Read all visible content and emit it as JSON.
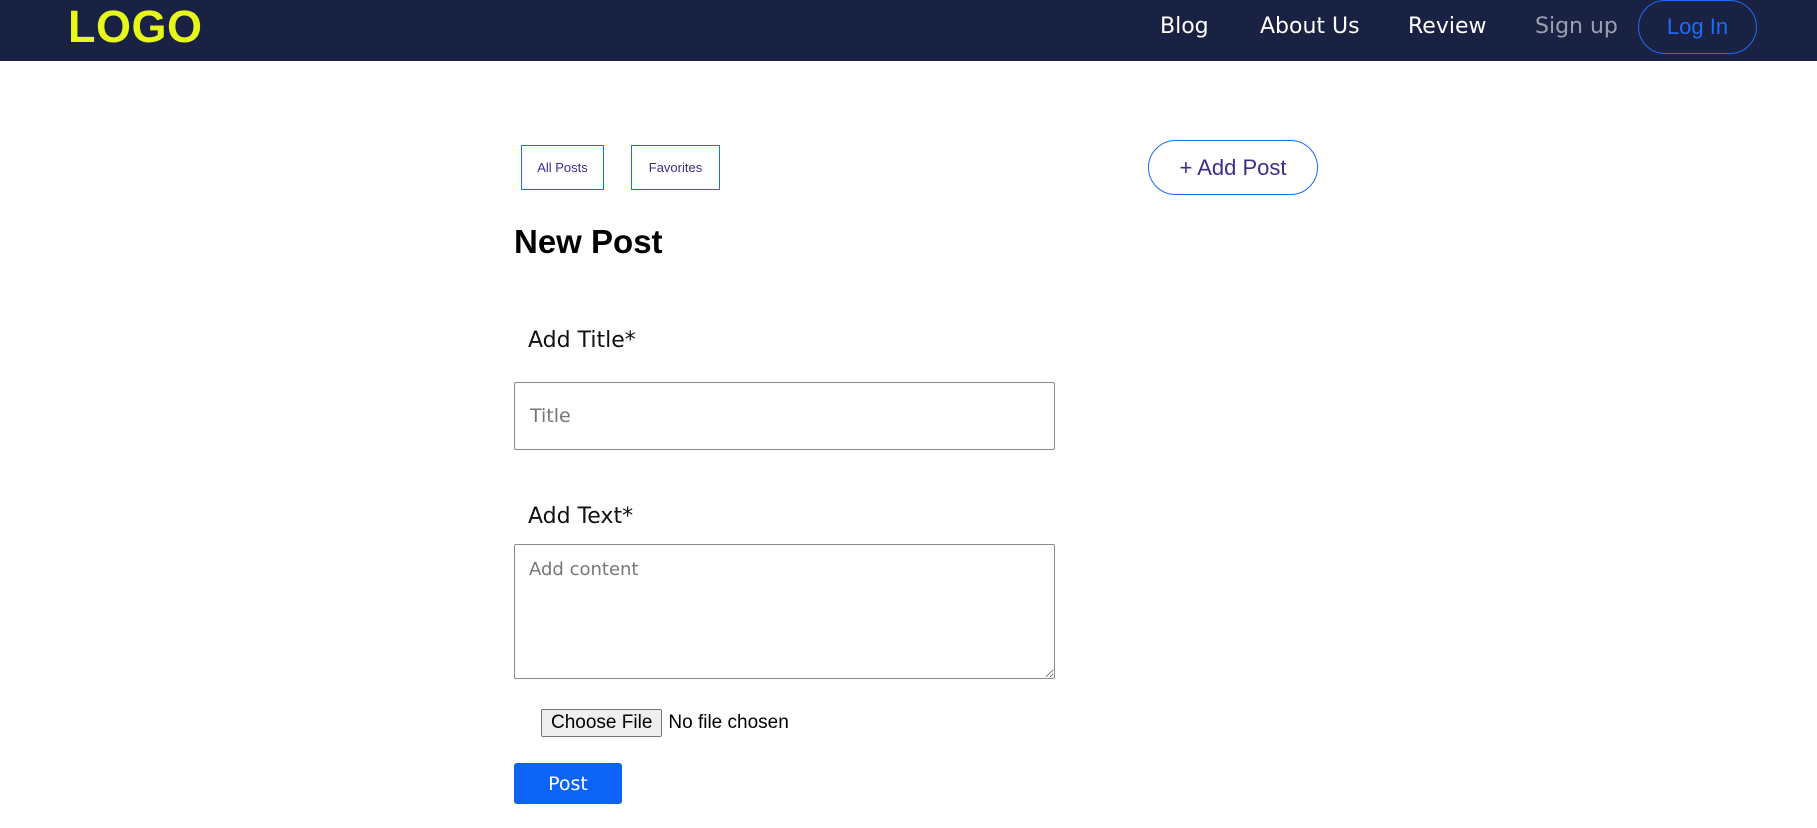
{
  "navbar": {
    "logo": "LOGO",
    "links": {
      "blog": "Blog",
      "about": "About Us",
      "review": "Review",
      "signup": "Sign up",
      "login": "Log In"
    }
  },
  "tabs": {
    "all_posts": "All Posts",
    "favorites": "Favorites"
  },
  "add_post_button": "+ Add Post",
  "form": {
    "heading": "New Post",
    "title_label": "Add Title*",
    "title_placeholder": "Title",
    "title_value": "",
    "text_label": "Add Text*",
    "text_placeholder": "Add content",
    "text_value": "",
    "file_button": "Choose File",
    "file_status": "No file chosen",
    "submit": "Post"
  },
  "colors": {
    "navbar_bg": "#1a2244",
    "logo": "#e6f719",
    "accent": "#1e6bf5",
    "primary_button": "#0d63f5",
    "muted_link": "#9aa0ae"
  }
}
